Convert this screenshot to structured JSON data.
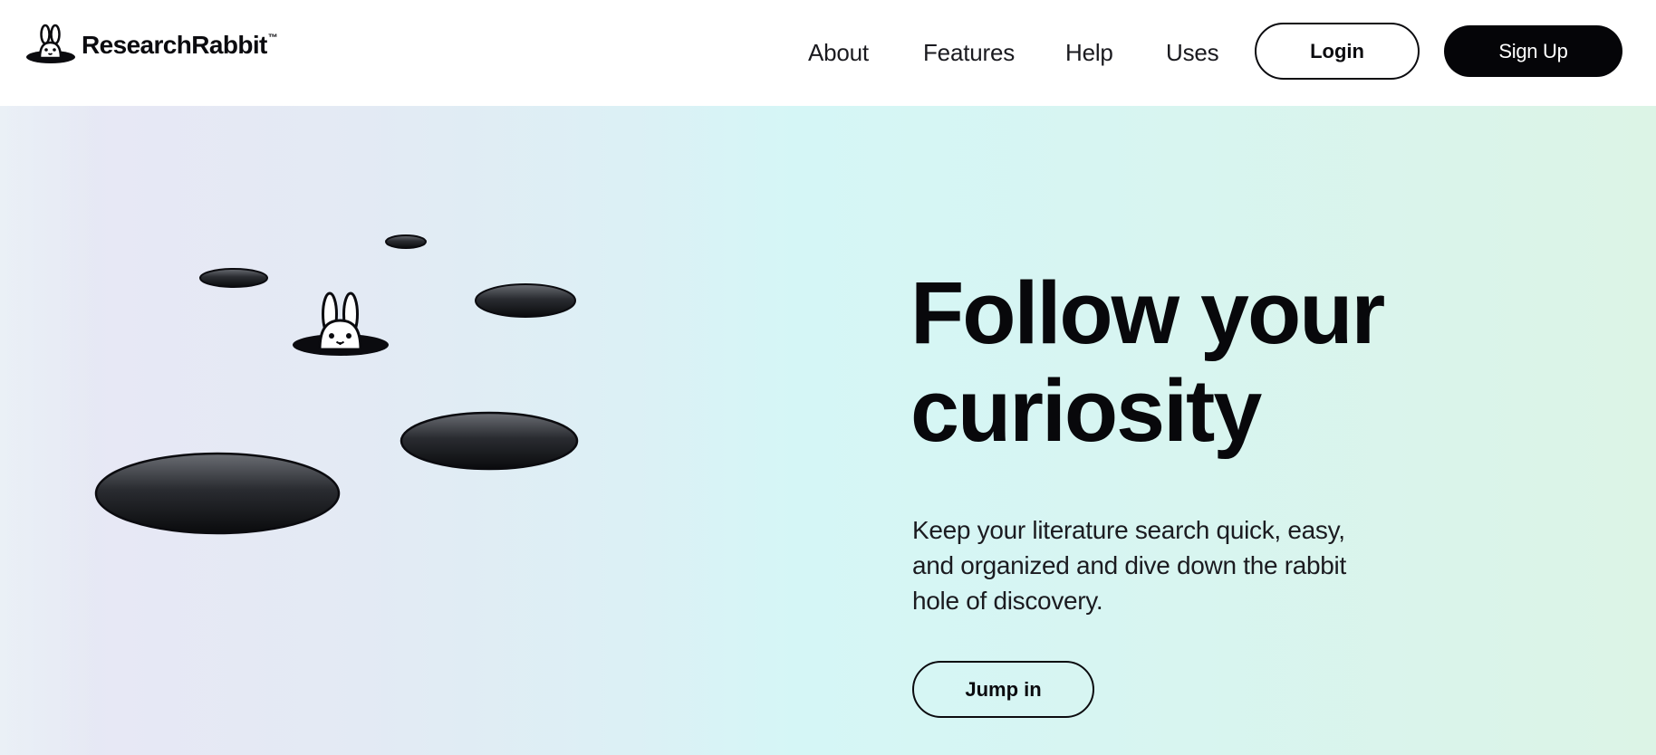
{
  "brand": {
    "name": "ResearchRabbit",
    "trademark": "™"
  },
  "nav": {
    "items": [
      {
        "label": "About"
      },
      {
        "label": "Features"
      },
      {
        "label": "Help"
      },
      {
        "label": "Uses"
      }
    ],
    "login_label": "Login",
    "signup_label": "Sign Up"
  },
  "hero": {
    "title": "Follow your curiosity",
    "subtitle": "Keep your literature search quick, easy, and organized and dive down the rabbit hole of discovery.",
    "cta_label": "Jump in"
  },
  "icons": {
    "logo": "rabbit-in-hole-logo",
    "illustration": "rabbit-holes-illustration"
  },
  "colors": {
    "text": "#0b0b0f",
    "button_dark": "#050508",
    "hero_gradient_start": "#e3ebf3",
    "hero_gradient_mid": "#d5f6f6",
    "hero_gradient_end": "#dcf4e6"
  }
}
